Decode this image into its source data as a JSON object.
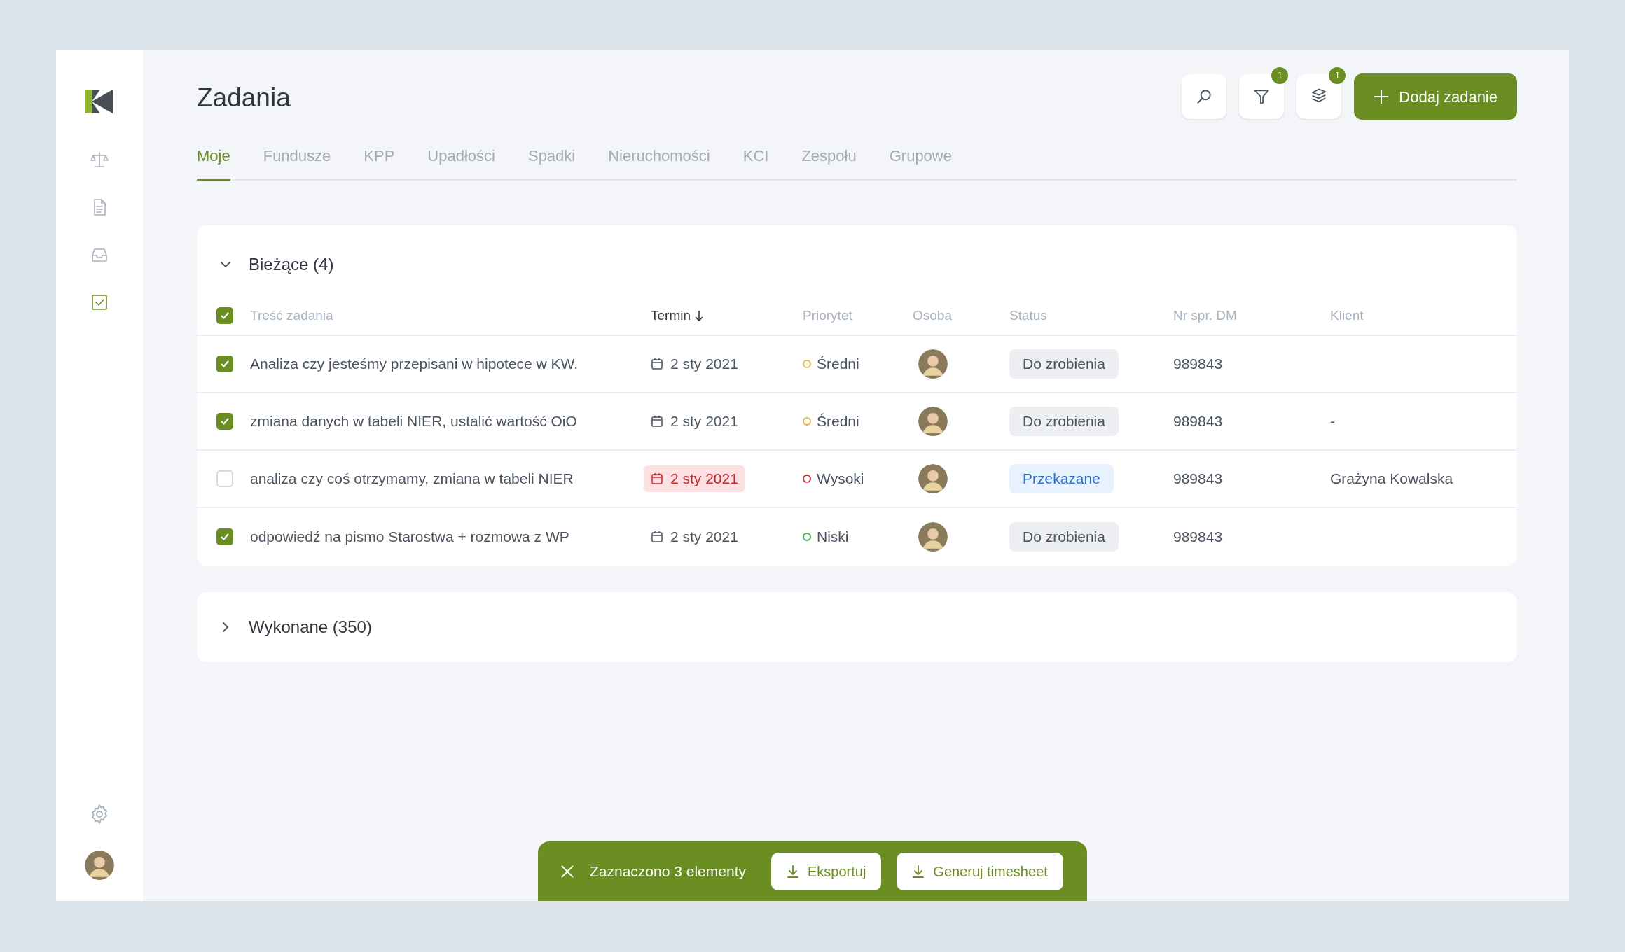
{
  "page": {
    "title": "Zadania"
  },
  "sidebar": {
    "items": [
      {
        "kind": "scale",
        "selected": false
      },
      {
        "kind": "document",
        "selected": false
      },
      {
        "kind": "inbox",
        "selected": false
      },
      {
        "kind": "tasks",
        "selected": true
      }
    ]
  },
  "toolbar": {
    "filter_badge": "1",
    "layers_badge": "1",
    "add_button": "Dodaj zadanie"
  },
  "tabs": [
    {
      "label": "Moje",
      "selected": true
    },
    {
      "label": "Fundusze",
      "selected": false
    },
    {
      "label": "KPP",
      "selected": false
    },
    {
      "label": "Upadłości",
      "selected": false
    },
    {
      "label": "Spadki",
      "selected": false
    },
    {
      "label": "Nieruchomości",
      "selected": false
    },
    {
      "label": "KCI",
      "selected": false
    },
    {
      "label": "Zespołu",
      "selected": false
    },
    {
      "label": "Grupowe",
      "selected": false
    }
  ],
  "current_group": {
    "title": "Bieżące (4)",
    "expanded": true,
    "all_checked": true,
    "columns": [
      {
        "label": "Treść zadania",
        "sorted": false
      },
      {
        "label": "Termin",
        "sorted": true
      },
      {
        "label": "Priorytet",
        "sorted": false
      },
      {
        "label": "Osoba",
        "sorted": false
      },
      {
        "label": "Status",
        "sorted": false
      },
      {
        "label": "Nr spr. DM",
        "sorted": false
      },
      {
        "label": "Klient",
        "sorted": false
      }
    ],
    "rows": [
      {
        "checked": true,
        "task": "Analiza czy jesteśmy przepisani w hipotece w KW.",
        "date": "2 sty 2021",
        "overdue": false,
        "priority": "Średni",
        "color": "#e8b84a",
        "status": {
          "label": "Do zrobienia",
          "kind": "todo"
        },
        "case_no": "989843"
      },
      {
        "checked": true,
        "task": "zmiana danych w tabeli NIER, ustalić wartość OiO",
        "date": "2 sty 2021",
        "overdue": false,
        "priority": "Średni",
        "color": "#e8b84a",
        "status": {
          "label": "Do zrobienia",
          "kind": "todo"
        },
        "case_no": "989843",
        "client": "-"
      },
      {
        "checked": false,
        "task": "analiza czy coś otrzymamy, zmiana w tabeli NIER",
        "date": "2 sty 2021",
        "overdue": true,
        "priority": "Wysoki",
        "color": "#d1343a",
        "status": {
          "label": "Przekazane",
          "kind": "handed"
        },
        "case_no": "989843",
        "client": "Grażyna Kowalska"
      },
      {
        "checked": true,
        "task": "odpowiedź na pismo Starostwa + rozmowa z WP",
        "date": "2 sty 2021",
        "overdue": false,
        "priority": "Niski",
        "color": "#3fae5a",
        "status": {
          "label": "Do zrobienia",
          "kind": "todo"
        },
        "case_no": "989843"
      }
    ]
  },
  "done_group": {
    "title": "Wykonane (350)",
    "expanded": false
  },
  "selection_bar": {
    "text": "Zaznaczono 3 elementy",
    "buttons": [
      "Eksportuj",
      "Generuj timesheet"
    ]
  }
}
